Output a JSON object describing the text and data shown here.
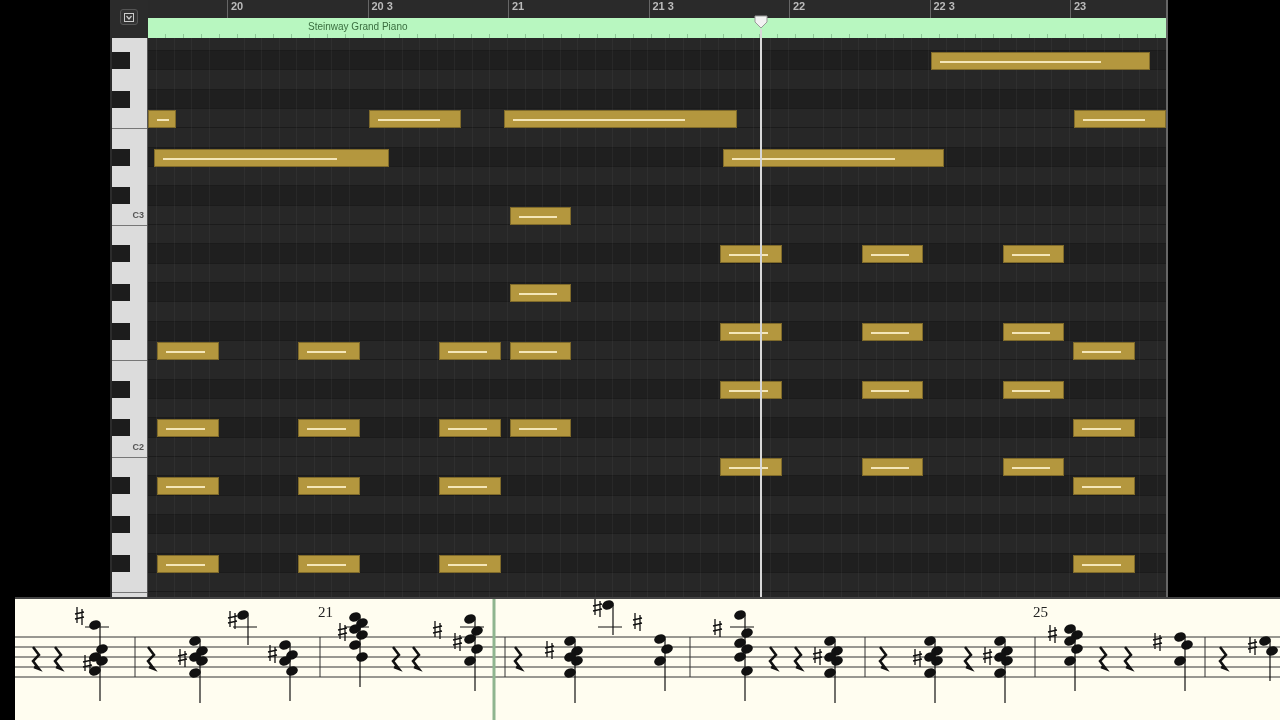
{
  "ruler": {
    "markers": [
      {
        "label": "20"
      },
      {
        "label": "20 3"
      },
      {
        "label": "21"
      },
      {
        "label": "21 3"
      },
      {
        "label": "22"
      },
      {
        "label": "22 3"
      },
      {
        "label": "23"
      }
    ]
  },
  "region": {
    "name": "Steinway Grand Piano"
  },
  "keyboard": {
    "labels": [
      {
        "text": "C3"
      },
      {
        "text": "C2"
      }
    ]
  },
  "score": {
    "measure_numbers": [
      {
        "text": "21"
      },
      {
        "text": "25"
      }
    ]
  }
}
